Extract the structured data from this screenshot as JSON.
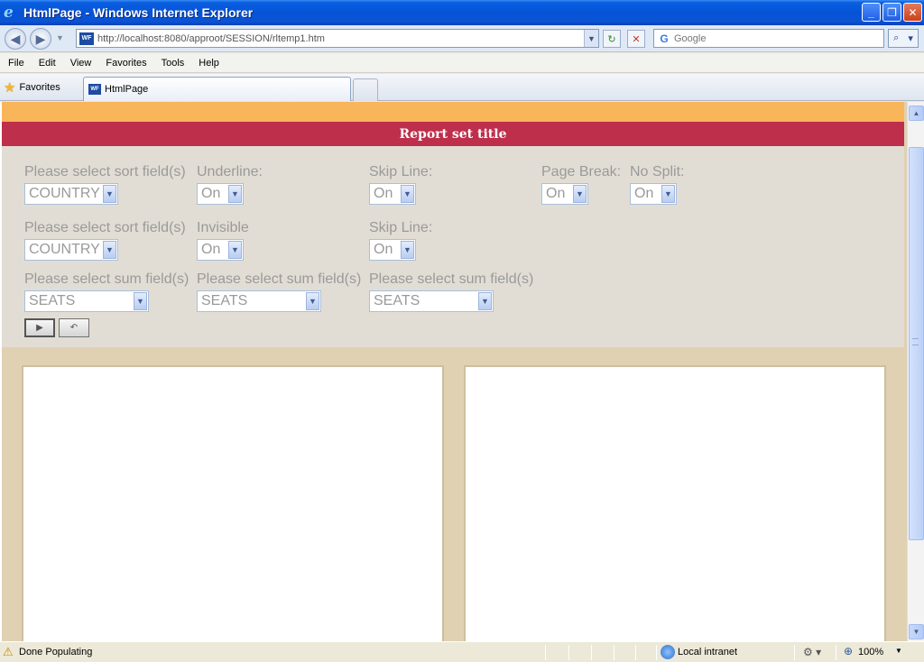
{
  "window": {
    "title": "HtmlPage - Windows Internet Explorer",
    "minimize": "_",
    "maximize": "❐",
    "close": "✕"
  },
  "nav": {
    "back": "◀",
    "forward": "▶",
    "url": "http://localhost:8080/approot/SESSION/rltemp1.htm",
    "refresh": "↻",
    "stop": "✕",
    "search_placeholder": "Google",
    "search_go": "⌕"
  },
  "menu": [
    "File",
    "Edit",
    "View",
    "Favorites",
    "Tools",
    "Help"
  ],
  "favorites": {
    "label": "Favorites"
  },
  "tab": {
    "label": "HtmlPage"
  },
  "page": {
    "report_title": "Report set title",
    "row1": {
      "sort_label": "Please select sort field(s)",
      "sort_value": "COUNTRY",
      "underline_label": "Underline:",
      "underline_value": "On",
      "skip_label": "Skip Line:",
      "skip_value": "On",
      "pagebreak_label": "Page Break:",
      "pagebreak_value": "On",
      "nosplit_label": "No Split:",
      "nosplit_value": "On"
    },
    "row2": {
      "sort_label": "Please select sort field(s)",
      "sort_value": "COUNTRY",
      "invisible_label": "Invisible",
      "invisible_value": "On",
      "skip_label": "Skip Line:",
      "skip_value": "On"
    },
    "row3": {
      "sum1_label": "Please select sum field(s)",
      "sum1_value": "SEATS",
      "sum2_label": "Please select sum field(s)",
      "sum2_value": "SEATS",
      "sum3_label": "Please select sum field(s)",
      "sum3_value": "SEATS"
    }
  },
  "status": {
    "text": "Done Populating",
    "zone": "Local intranet",
    "zoom": "100%"
  }
}
